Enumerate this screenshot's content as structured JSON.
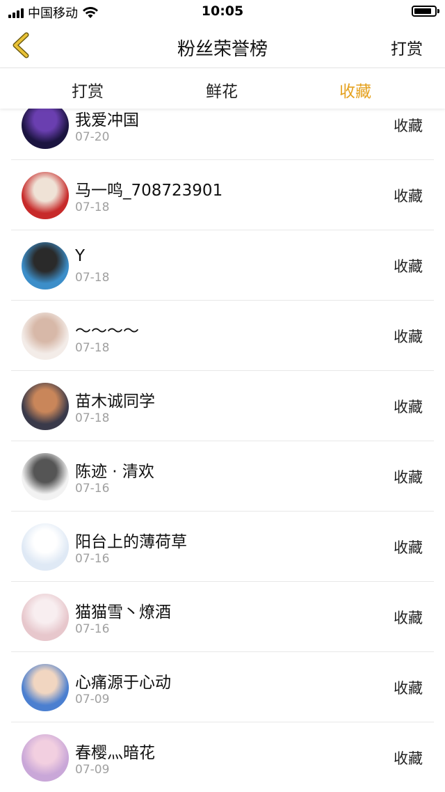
{
  "status": {
    "carrier": "中国移动",
    "time": "10:05"
  },
  "nav": {
    "title": "粉丝荣誉榜",
    "right_label": "打赏"
  },
  "tabs": [
    {
      "label": "打赏"
    },
    {
      "label": "鲜花"
    },
    {
      "label": "收藏"
    }
  ],
  "colors": {
    "accent": "#e5a220",
    "back_icon": "#e9c237"
  },
  "rows": [
    {
      "name": "我爱冲国",
      "date": "07-20",
      "action": "收藏",
      "avatar_color": "#1b1440",
      "avatar_accent": "#6a3fb0"
    },
    {
      "name": "马一鸣_708723901",
      "date": "07-18",
      "action": "收藏",
      "avatar_color": "#c72a2a",
      "avatar_accent": "#efe2d6"
    },
    {
      "name": "Y",
      "date": "07-18",
      "action": "收藏",
      "avatar_color": "#3c8ec9",
      "avatar_accent": "#2a2a2a"
    },
    {
      "name": "～～～～",
      "date": "07-18",
      "action": "收藏",
      "avatar_color": "#f3ece8",
      "avatar_accent": "#d7b8a8"
    },
    {
      "name": "苗木诚同学",
      "date": "07-18",
      "action": "收藏",
      "avatar_color": "#3a3a4a",
      "avatar_accent": "#c9865a"
    },
    {
      "name": "陈迹 · 清欢",
      "date": "07-16",
      "action": "收藏",
      "avatar_color": "#f2f2f2",
      "avatar_accent": "#555555"
    },
    {
      "name": "阳台上的薄荷草",
      "date": "07-16",
      "action": "收藏",
      "avatar_color": "#dfe9f5",
      "avatar_accent": "#ffffff"
    },
    {
      "name": "猫猫雪丶燎酒",
      "date": "07-16",
      "action": "收藏",
      "avatar_color": "#e7c7cc",
      "avatar_accent": "#f8eef0"
    },
    {
      "name": "心痛源于心动",
      "date": "07-09",
      "action": "收藏",
      "avatar_color": "#4b7fd0",
      "avatar_accent": "#f1d6c1"
    },
    {
      "name": "春樱灬暗花",
      "date": "07-09",
      "action": "收藏",
      "avatar_color": "#c9a7d8",
      "avatar_accent": "#f2cfe0"
    }
  ]
}
